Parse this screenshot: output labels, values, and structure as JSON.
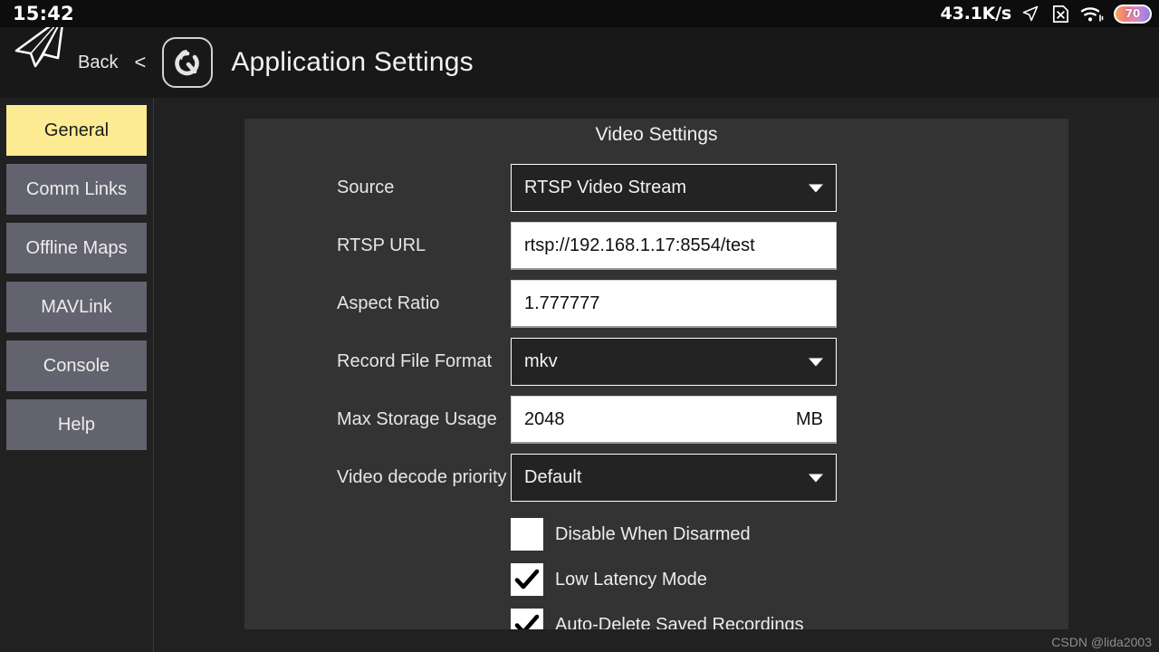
{
  "statusbar": {
    "clock": "15:42",
    "network_speed": "43.1K/s",
    "location_icon": "navigation-arrow-icon",
    "sim_icon": "no-sim-icon",
    "wifi_icon": "wifi-icon",
    "battery_level": "70"
  },
  "header": {
    "logo_icon": "paper-plane-icon",
    "back_label": "Back",
    "back_chevron": "<",
    "app_icon": "qgroundcontrol-icon",
    "title": "Application Settings"
  },
  "sidebar": {
    "items": [
      {
        "label": "General",
        "active": true
      },
      {
        "label": "Comm Links",
        "active": false
      },
      {
        "label": "Offline Maps",
        "active": false
      },
      {
        "label": "MAVLink",
        "active": false
      },
      {
        "label": "Console",
        "active": false
      },
      {
        "label": "Help",
        "active": false
      }
    ]
  },
  "panel": {
    "title": "Video Settings",
    "rows": [
      {
        "label": "Source",
        "type": "combo",
        "value": "RTSP Video Stream"
      },
      {
        "label": "RTSP URL",
        "type": "text",
        "value": "rtsp://192.168.1.17:8554/test",
        "unit": ""
      },
      {
        "label": "Aspect Ratio",
        "type": "text",
        "value": "1.777777",
        "unit": ""
      },
      {
        "label": "Record File Format",
        "type": "combo",
        "value": "mkv"
      },
      {
        "label": "Max Storage Usage",
        "type": "text",
        "value": "2048",
        "unit": "MB"
      },
      {
        "label": "Video decode priority",
        "type": "combo",
        "value": "Default"
      }
    ],
    "checkboxes": [
      {
        "label": "Disable When Disarmed",
        "checked": false
      },
      {
        "label": "Low Latency Mode",
        "checked": true
      },
      {
        "label": "Auto-Delete Saved Recordings",
        "checked": true
      }
    ]
  },
  "watermark": "CSDN @lida2003",
  "colors": {
    "page_bg": "#212121",
    "panel_bg": "#333333",
    "statusbar_bg": "#0d0d0d",
    "header_bg": "#181818",
    "sidebar_button": "#63636f",
    "sidebar_active": "#fdeb93",
    "field_white": "#ffffff",
    "combo_bg": "#232323"
  }
}
